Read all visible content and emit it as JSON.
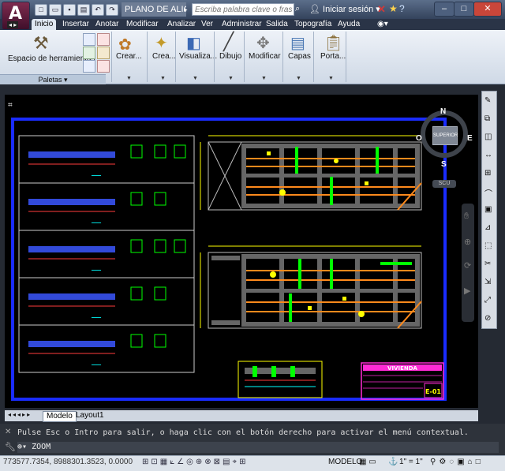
{
  "window": {
    "app_version": "A",
    "doc_title": "PLANO DE ALIGER...",
    "search_placeholder": "Escriba palabra clave o frase",
    "user_label": "Iniciar sesión"
  },
  "menu": [
    "Inicio",
    "Insertar",
    "Anotar",
    "Modificar",
    "Analizar",
    "Ver",
    "Administrar",
    "Salida",
    "Topografía",
    "Ayuda"
  ],
  "ribbon": {
    "tools_label": "Espacio de herramientas",
    "palettes_label": "Paletas",
    "groups": [
      "Crear...",
      "Crea...",
      "Visualiza...",
      "Dibujo",
      "Modificar",
      "Capas",
      "Porta..."
    ]
  },
  "viewcube": {
    "north": "N",
    "south": "S",
    "east": "E",
    "west": "O",
    "face": "SUPERIOR",
    "wcs": "SCU"
  },
  "layout_tabs": [
    "Modelo",
    "Layout1"
  ],
  "command": {
    "history": "Pulse Esc o Intro para salir, o haga clic con el botón derecho para activar el menú contextual.",
    "current": "ZOOM"
  },
  "status": {
    "coords": "773577.7354, 8988301.3523, 0.0000",
    "space": "MODELO",
    "scale": "1\" = 1\""
  },
  "drawing": {
    "title_block_heading": "VIVIENDA",
    "sheet_id": "E-01"
  },
  "colors": {
    "canvas": "#000000",
    "frame": "#1a2cff",
    "accent": "#7f2b4f"
  }
}
